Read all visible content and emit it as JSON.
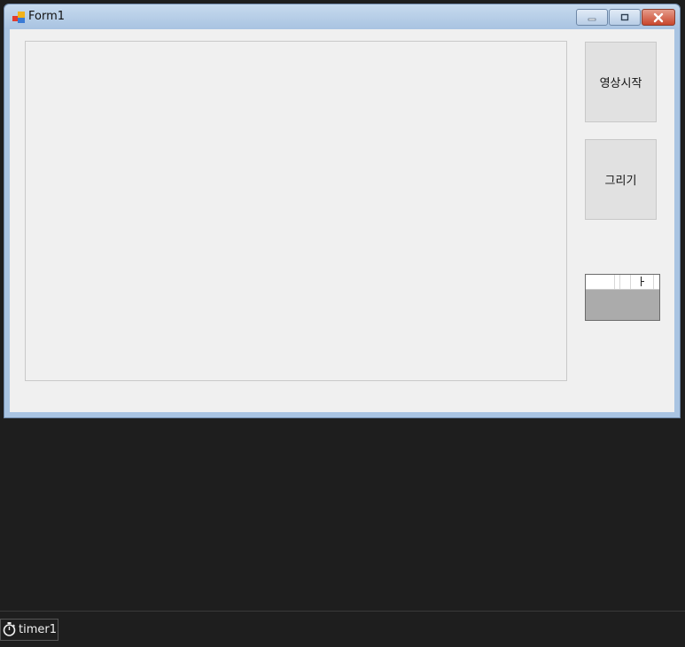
{
  "form": {
    "title": "Form1",
    "icon": "winforms-form-icon",
    "controls": {
      "start_button": "영상시작",
      "draw_button": "그리기"
    }
  },
  "caption_buttons": [
    "minimize-icon",
    "maximize-icon",
    "close-icon"
  ],
  "component_tray": {
    "items": [
      {
        "icon": "stopwatch-icon",
        "label": "timer1"
      }
    ]
  },
  "colors": {
    "designer_bg": "#1e1e1e",
    "form_bg": "#f0f0f0",
    "titlebar": "#a8c3e1",
    "close_button": "#c9472d"
  }
}
